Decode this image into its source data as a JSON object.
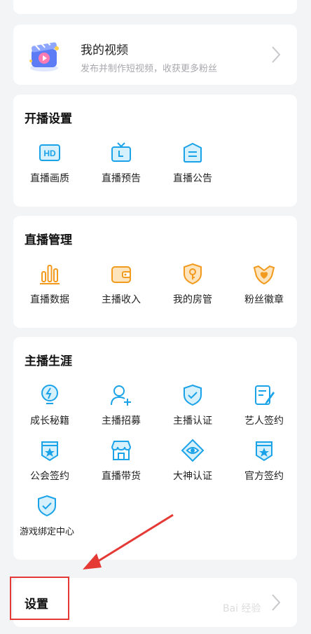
{
  "video": {
    "title": "我的视频",
    "subtitle": "发布并制作短视频，收获更多粉丝"
  },
  "sections": {
    "broadcast_settings": {
      "title": "开播设置",
      "items": [
        {
          "label": "直播画质",
          "icon": "hd-icon"
        },
        {
          "label": "直播预告",
          "icon": "tv-icon"
        },
        {
          "label": "直播公告",
          "icon": "announcement-icon"
        }
      ]
    },
    "live_management": {
      "title": "直播管理",
      "items": [
        {
          "label": "直播数据",
          "icon": "bar-chart-icon"
        },
        {
          "label": "主播收入",
          "icon": "wallet-icon"
        },
        {
          "label": "我的房管",
          "icon": "shield-key-icon"
        },
        {
          "label": "粉丝徽章",
          "icon": "heart-badge-icon"
        }
      ]
    },
    "streamer_career": {
      "title": "主播生涯",
      "items": [
        {
          "label": "成长秘籍",
          "icon": "lightbulb-icon"
        },
        {
          "label": "主播招募",
          "icon": "add-user-icon"
        },
        {
          "label": "主播认证",
          "icon": "shield-check-icon"
        },
        {
          "label": "艺人签约",
          "icon": "sign-document-icon"
        },
        {
          "label": "公会签约",
          "icon": "guild-badge-icon"
        },
        {
          "label": "直播带货",
          "icon": "shop-icon"
        },
        {
          "label": "大神认证",
          "icon": "diamond-eye-icon"
        },
        {
          "label": "官方签约",
          "icon": "official-badge-icon"
        },
        {
          "label": "游戏绑定中心",
          "icon": "game-shield-icon"
        }
      ]
    }
  },
  "settings": {
    "label": "设置"
  },
  "watermark": {
    "text": "Bai 经验"
  },
  "colors": {
    "accent_blue": "#1aa3e8",
    "accent_orange": "#f29a1e",
    "highlight_red": "#e53935"
  }
}
